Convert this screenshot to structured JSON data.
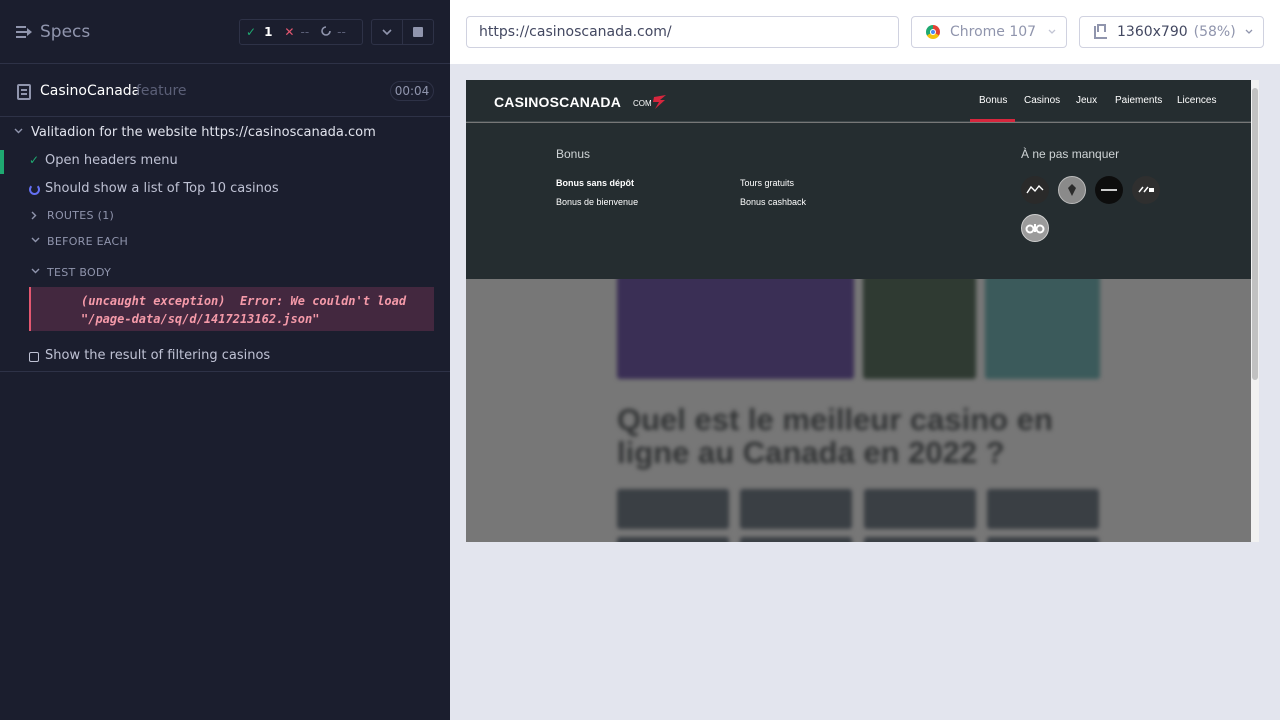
{
  "reporter": {
    "header": {
      "title": "Specs",
      "stats": {
        "passed": "1",
        "failed": "--",
        "pending": "--"
      }
    },
    "spec": {
      "name": "CasinoCanada",
      "ext": "feature",
      "duration": "00:04"
    },
    "suite": {
      "title": "Valitadion for the website https://casinoscanada.com",
      "tests": [
        {
          "title": "Open headers menu",
          "state": "passed"
        },
        {
          "title": "Should show a list of Top 10 casinos",
          "state": "running"
        },
        {
          "title": "Show the result of filtering casinos",
          "state": "pending"
        }
      ],
      "hooks": [
        {
          "label": "ROUTES (1)",
          "expanded": false
        },
        {
          "label": "BEFORE EACH",
          "expanded": true
        },
        {
          "label": "TEST BODY",
          "expanded": true
        }
      ],
      "error": "(uncaught exception)  Error: We couldn't load \"/page-data/sq/d/1417213162.json\""
    }
  },
  "aut": {
    "url": "https://casinoscanada.com/",
    "browser": "Chrome 107",
    "viewport": "1360x790",
    "scale": "(58%)"
  },
  "site": {
    "logo": "CASINOSCANADA",
    "logo_suffix": "COM",
    "nav": [
      "Bonus",
      "Casinos",
      "Jeux",
      "Paiements",
      "Licences"
    ],
    "active_nav": "Bonus",
    "mega": {
      "heading": "Bonus",
      "links": [
        "Bonus sans dépôt",
        "Tours gratuits",
        "Bonus de bienvenue",
        "Bonus cashback"
      ],
      "promo_heading": "À ne pas manquer",
      "casino_logos": [
        "7bit-casino-logo",
        "leovegas-logo",
        "playamo-logo",
        "22bet-logo",
        "ojo-logo"
      ]
    },
    "background_heading": "Quel est le meilleur casino en ligne au Canada en 2022 ?"
  },
  "colors": {
    "reporter_bg": "#1b1e2e",
    "passed": "#1fa971",
    "failed": "#e45770",
    "running": "#6470f3",
    "site_nav_bg": "#252d30",
    "site_accent": "#d7263d"
  }
}
